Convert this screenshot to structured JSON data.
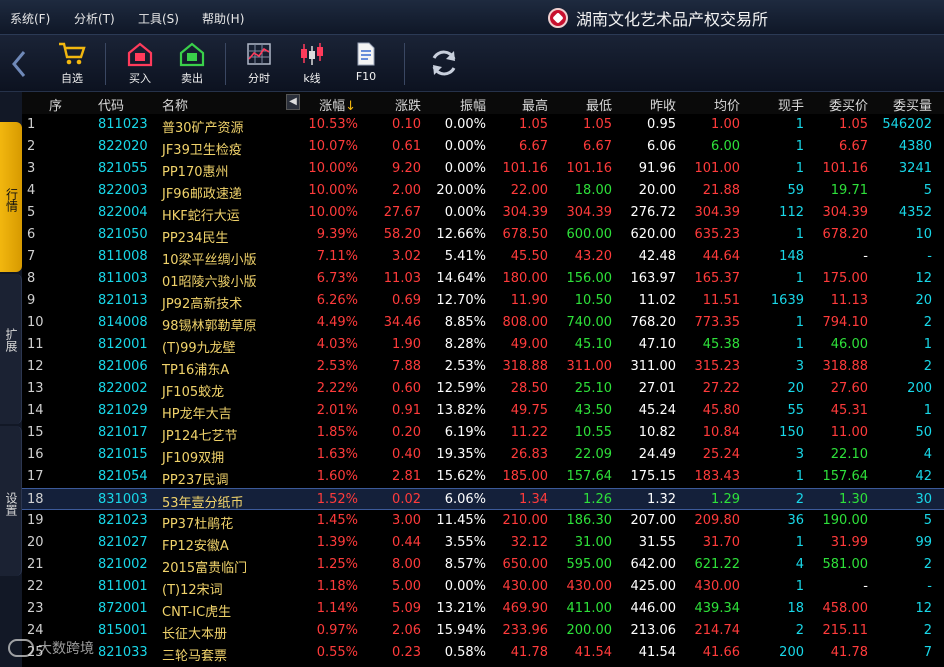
{
  "menu": {
    "items": [
      "系统(F)",
      "分析(T)",
      "工具(S)",
      "帮助(H)"
    ]
  },
  "brand": {
    "title": "湖南文化艺术品产权交易所"
  },
  "toolbar": {
    "buttons": [
      {
        "label": "自选",
        "icon": "cart-icon"
      },
      {
        "label": "买入",
        "icon": "buy-house-icon"
      },
      {
        "label": "卖出",
        "icon": "sell-house-icon"
      },
      {
        "label": "分时",
        "icon": "timeshare-grid-icon"
      },
      {
        "label": "k线",
        "icon": "candlestick-icon"
      },
      {
        "label": "F10",
        "icon": "document-icon"
      }
    ],
    "refresh_icon": "refresh-icon",
    "back_icon": "back-arrow-icon"
  },
  "sidetabs": [
    {
      "label": "行情",
      "active": true
    },
    {
      "label": "扩展",
      "active": false
    },
    {
      "label": "设置",
      "active": false
    }
  ],
  "table": {
    "headers": [
      "序",
      "代码",
      "名称",
      "涨幅",
      "涨跌",
      "振幅",
      "最高",
      "最低",
      "昨收",
      "均价",
      "现手",
      "委买价",
      "委买量"
    ],
    "sort_indicator": "↓",
    "rows": [
      [
        "1",
        "811023",
        "普30矿产资源",
        "10.53%",
        "0.10",
        "0.00%",
        "1.05",
        "1.05",
        "0.95",
        "1.00",
        "1",
        "1.05",
        "546202"
      ],
      [
        "2",
        "822020",
        "JF39卫生检疫",
        "10.07%",
        "0.61",
        "0.00%",
        "6.67",
        "6.67",
        "6.06",
        "6.00",
        "1",
        "6.67",
        "4380"
      ],
      [
        "3",
        "821055",
        "PP170惠州",
        "10.00%",
        "9.20",
        "0.00%",
        "101.16",
        "101.16",
        "91.96",
        "101.00",
        "1",
        "101.16",
        "3241"
      ],
      [
        "4",
        "822003",
        "JF96邮政速递",
        "10.00%",
        "2.00",
        "20.00%",
        "22.00",
        "18.00",
        "20.00",
        "21.88",
        "59",
        "19.71",
        "5"
      ],
      [
        "5",
        "822004",
        "HKF蛇行大运",
        "10.00%",
        "27.67",
        "0.00%",
        "304.39",
        "304.39",
        "276.72",
        "304.39",
        "112",
        "304.39",
        "4352"
      ],
      [
        "6",
        "821050",
        "PP234民生",
        "9.39%",
        "58.20",
        "12.66%",
        "678.50",
        "600.00",
        "620.00",
        "635.23",
        "1",
        "678.20",
        "10"
      ],
      [
        "7",
        "811008",
        "10梁平丝绸小版",
        "7.11%",
        "3.02",
        "5.41%",
        "45.50",
        "43.20",
        "42.48",
        "44.64",
        "148",
        "-",
        "-"
      ],
      [
        "8",
        "811003",
        "01昭陵六骏小版",
        "6.73%",
        "11.03",
        "14.64%",
        "180.00",
        "156.00",
        "163.97",
        "165.37",
        "1",
        "175.00",
        "12"
      ],
      [
        "9",
        "821013",
        "JP92高新技术",
        "6.26%",
        "0.69",
        "12.70%",
        "11.90",
        "10.50",
        "11.02",
        "11.51",
        "1639",
        "11.13",
        "20"
      ],
      [
        "10",
        "814008",
        "98锡林郭勒草原",
        "4.49%",
        "34.46",
        "8.85%",
        "808.00",
        "740.00",
        "768.20",
        "773.35",
        "1",
        "794.10",
        "2"
      ],
      [
        "11",
        "812001",
        "(T)99九龙壁",
        "4.03%",
        "1.90",
        "8.28%",
        "49.00",
        "45.10",
        "47.10",
        "45.38",
        "1",
        "46.00",
        "1"
      ],
      [
        "12",
        "821006",
        "TP16浦东A",
        "2.53%",
        "7.88",
        "2.53%",
        "318.88",
        "311.00",
        "311.00",
        "315.23",
        "3",
        "318.88",
        "2"
      ],
      [
        "13",
        "822002",
        "JF105蛟龙",
        "2.22%",
        "0.60",
        "12.59%",
        "28.50",
        "25.10",
        "27.01",
        "27.22",
        "20",
        "27.60",
        "200"
      ],
      [
        "14",
        "821029",
        "HP龙年大吉",
        "2.01%",
        "0.91",
        "13.82%",
        "49.75",
        "43.50",
        "45.24",
        "45.80",
        "55",
        "45.31",
        "1"
      ],
      [
        "15",
        "821017",
        "JP124七艺节",
        "1.85%",
        "0.20",
        "6.19%",
        "11.22",
        "10.55",
        "10.82",
        "10.84",
        "150",
        "11.00",
        "50"
      ],
      [
        "16",
        "821015",
        "JF109双拥",
        "1.63%",
        "0.40",
        "19.35%",
        "26.83",
        "22.09",
        "24.49",
        "25.24",
        "3",
        "22.10",
        "4"
      ],
      [
        "17",
        "821054",
        "PP237民调",
        "1.60%",
        "2.81",
        "15.62%",
        "185.00",
        "157.64",
        "175.15",
        "183.43",
        "1",
        "157.64",
        "42"
      ],
      [
        "18",
        "831003",
        "53年壹分纸币",
        "1.52%",
        "0.02",
        "6.06%",
        "1.34",
        "1.26",
        "1.32",
        "1.29",
        "2",
        "1.30",
        "30"
      ],
      [
        "19",
        "821023",
        "PP37杜鹃花",
        "1.45%",
        "3.00",
        "11.45%",
        "210.00",
        "186.30",
        "207.00",
        "209.80",
        "36",
        "190.00",
        "5"
      ],
      [
        "20",
        "821027",
        "FP12安徽A",
        "1.39%",
        "0.44",
        "3.55%",
        "32.12",
        "31.00",
        "31.55",
        "31.70",
        "1",
        "31.99",
        "99"
      ],
      [
        "21",
        "821002",
        "2015富贵临门",
        "1.25%",
        "8.00",
        "8.57%",
        "650.00",
        "595.00",
        "642.00",
        "621.22",
        "4",
        "581.00",
        "2"
      ],
      [
        "22",
        "811001",
        "(T)12宋词",
        "1.18%",
        "5.00",
        "0.00%",
        "430.00",
        "430.00",
        "425.00",
        "430.00",
        "1",
        "-",
        "-"
      ],
      [
        "23",
        "872001",
        "CNT-IC虎生",
        "1.14%",
        "5.09",
        "13.21%",
        "469.90",
        "411.00",
        "446.00",
        "439.34",
        "18",
        "458.00",
        "12"
      ],
      [
        "24",
        "815001",
        "长征大本册",
        "0.97%",
        "2.06",
        "15.94%",
        "233.96",
        "200.00",
        "213.06",
        "214.74",
        "2",
        "215.11",
        "2"
      ],
      [
        "25",
        "821033",
        "三轮马套票",
        "0.55%",
        "0.23",
        "0.58%",
        "41.78",
        "41.54",
        "41.54",
        "41.66",
        "200",
        "41.78",
        "7"
      ]
    ],
    "selected_row": 18
  },
  "watermark": {
    "text": "大数跨境"
  },
  "colors": {
    "up": "#ff3b3b",
    "down": "#2ee03a",
    "code": "#19d7e8",
    "name": "#f1d36b",
    "accent_tab": "#f2b70f"
  }
}
